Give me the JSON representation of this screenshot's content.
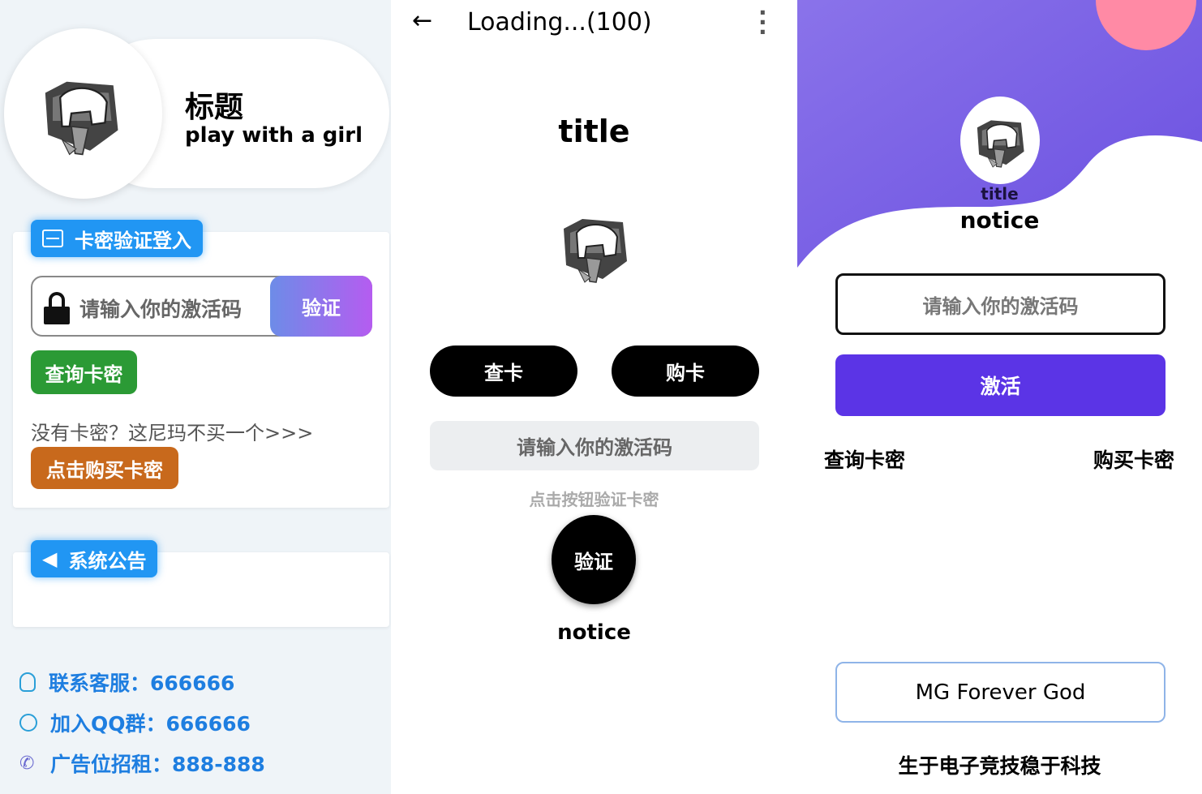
{
  "panel1": {
    "header": {
      "title": "标题",
      "subtitle": "play with a girl"
    },
    "login": {
      "tag": "卡密验证登入",
      "placeholder": "请输入你的激活码",
      "verify": "验证",
      "query": "查询卡密",
      "hint": "没有卡密？这尼玛不买一个>>>",
      "buy": "点击购买卡密"
    },
    "notice": {
      "tag": "系统公告"
    },
    "contacts": [
      {
        "label": "联系客服：",
        "value": "666666",
        "icon": "qq-penguin-icon"
      },
      {
        "label": "加入QQ群：",
        "value": "666666",
        "icon": "headset-icon"
      },
      {
        "label": "广告位招租：",
        "value": "888-888",
        "icon": "phone-icon"
      }
    ],
    "colors": {
      "accent": "#2196f3",
      "green": "#2b9a35",
      "orange": "#c8691c"
    }
  },
  "panel2": {
    "toolbar": {
      "title": "Loading...(100)"
    },
    "title": "title",
    "check": "查卡",
    "buy": "购卡",
    "placeholder": "请输入你的激活码",
    "hint": "点击按钮验证卡密",
    "verify": "验证",
    "notice": "notice"
  },
  "panel3": {
    "title": "title",
    "notice": "notice",
    "placeholder": "请输入你的激活码",
    "activate": "激活",
    "query": "查询卡密",
    "buy": "购买卡密",
    "footer_button": "MG Forever God",
    "slogan": "生于电子竞技稳于科技",
    "colors": {
      "primary": "#5b34e6",
      "bg": "#7b63e6",
      "pink": "#ff8aa5"
    }
  }
}
